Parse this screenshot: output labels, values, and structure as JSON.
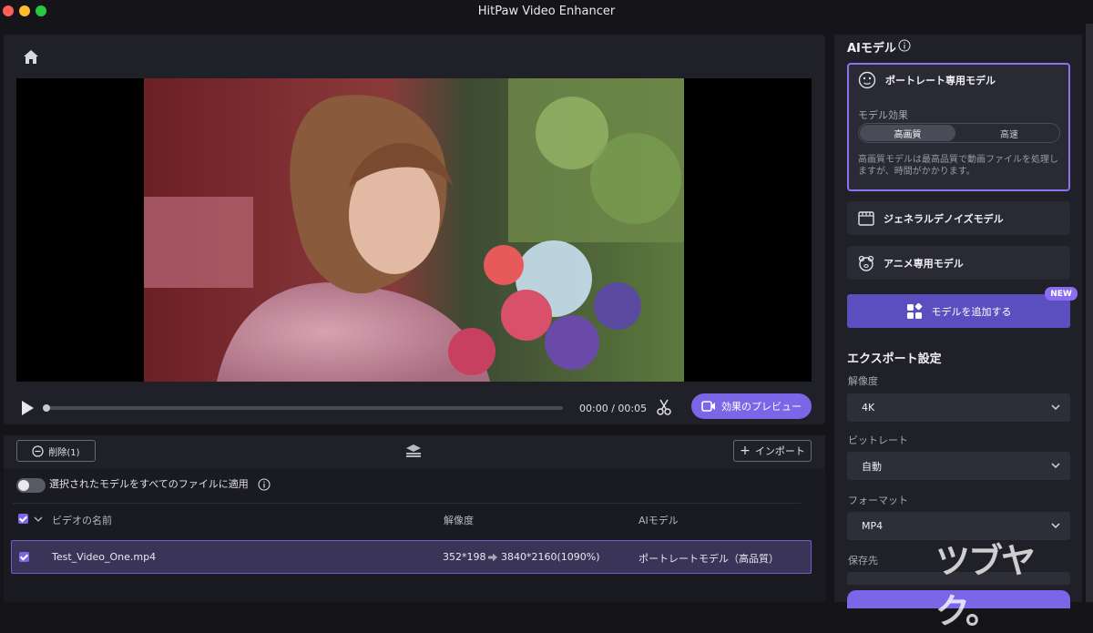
{
  "app": {
    "title": "HitPaw Video Enhancer"
  },
  "player": {
    "time": "00:00 / 00:05",
    "preview_label": "効果のプレビュー",
    "progress": 0
  },
  "list": {
    "delete_label": "削除(1)",
    "import_label": "インポート",
    "apply_all_label": "選択されたモデルをすべてのファイルに適用",
    "apply_all_enabled": false,
    "columns": {
      "name": "ビデオの名前",
      "resolution": "解像度",
      "model": "AIモデル"
    },
    "rows": [
      {
        "name": "Test_Video_One.mp4",
        "source_res": "352*198",
        "target_res": "3840*2160(1090%)",
        "model": "ポートレートモデル（高品質）",
        "checked": true
      }
    ]
  },
  "sidebar": {
    "ai_model_heading": "AIモデル",
    "portrait": {
      "title": "ポートレート専用モデル",
      "effect_label": "モデル効果",
      "quality_option": "高画質",
      "speed_option": "高速",
      "selected_option": "高画質",
      "description": "高画質モデルは最高品質で動画ファイルを処理しますが、時間がかかります。"
    },
    "denoise_title": "ジェネラルデノイズモデル",
    "anime_title": "アニメ専用モデル",
    "add_model_label": "モデルを追加する",
    "new_badge": "NEW",
    "export_heading": "エクスポート設定",
    "resolution_label": "解像度",
    "resolution_value": "4K",
    "bitrate_label": "ビットレート",
    "bitrate_value": "自動",
    "format_label": "フォーマット",
    "format_value": "MP4",
    "save_label": "保存先"
  },
  "watermark": "ツブヤク。",
  "colors": {
    "accent": "#7b66e8",
    "panel": "#202028",
    "background": "#141419",
    "row_selected": "#3a3558"
  }
}
